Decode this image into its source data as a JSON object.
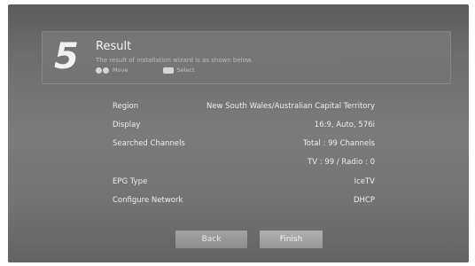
{
  "header": {
    "step_number": "5",
    "title": "Result",
    "description": "The result of installation wizard is as shown below.",
    "hint_move_label": "Move",
    "hint_select_label": "Select"
  },
  "settings": {
    "region_label": "Region",
    "region_value": "New South Wales/Australian Capital Territory",
    "display_label": "Display",
    "display_value": "16:9, Auto, 576i",
    "searched_label": "Searched Channels",
    "searched_total": "Total : 99 Channels",
    "searched_breakdown": "TV : 99 / Radio : 0",
    "epg_label": "EPG Type",
    "epg_value": "IceTV",
    "network_label": "Configure Network",
    "network_value": "DHCP"
  },
  "buttons": {
    "back_label": "Back",
    "finish_label": "Finish"
  }
}
